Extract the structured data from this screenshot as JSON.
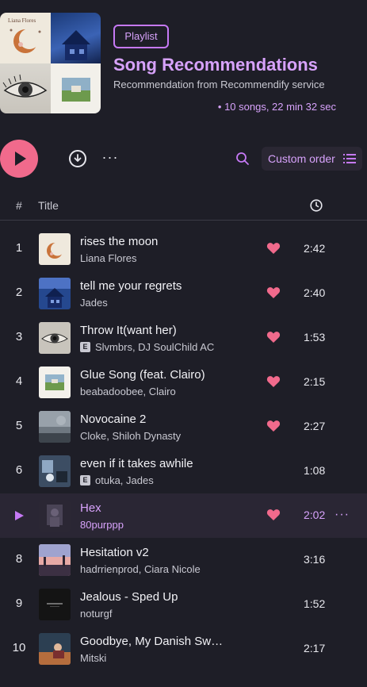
{
  "playlist": {
    "badge": "Playlist",
    "title": "Song Recommendations",
    "subtitle": "Recommendation from Recommendify service",
    "stats": "• 10 songs, 22 min 32 sec",
    "cover_text": "Liana Flores"
  },
  "controls": {
    "more_label": "···",
    "order_label": "Custom order"
  },
  "table": {
    "num_header": "#",
    "title_header": "Title"
  },
  "colors": {
    "accent": "#d7a2fb",
    "play_button": "#f16a8c",
    "heart": "#f16a8c",
    "background": "#1e1e27"
  },
  "tracks": [
    {
      "num": "1",
      "title": "rises the moon",
      "artist": "Liana Flores",
      "explicit": false,
      "liked": true,
      "duration": "2:42",
      "art": "art-moon"
    },
    {
      "num": "2",
      "title": "tell me your regrets",
      "artist": "Jades",
      "explicit": false,
      "liked": true,
      "duration": "2:40",
      "art": "art-house"
    },
    {
      "num": "3",
      "title": "Throw It(want her)",
      "artist": "Slvmbrs, DJ SoulChild AC",
      "explicit": true,
      "liked": true,
      "duration": "1:53",
      "art": "art-eye"
    },
    {
      "num": "4",
      "title": "Glue Song (feat. Clairo)",
      "artist": "beabadoobee, Clairo",
      "explicit": false,
      "liked": true,
      "duration": "2:15",
      "art": "art-field"
    },
    {
      "num": "5",
      "title": "Novocaine 2",
      "artist": "Cloke, Shiloh Dynasty",
      "explicit": false,
      "liked": true,
      "duration": "2:27",
      "art": "art-storm"
    },
    {
      "num": "6",
      "title": "even if it takes awhile",
      "artist": "otuka, Jades",
      "explicit": true,
      "liked": false,
      "duration": "1:08",
      "art": "art-room"
    },
    {
      "num": "",
      "title": "Hex",
      "artist": "80purppp",
      "explicit": false,
      "liked": true,
      "duration": "2:02",
      "art": "art-hex",
      "active": true
    },
    {
      "num": "8",
      "title": "Hesitation v2",
      "artist": "hadrrienprod, Ciara Nicole",
      "explicit": false,
      "liked": false,
      "duration": "3:16",
      "art": "art-sunset"
    },
    {
      "num": "9",
      "title": "Jealous - Sped Up",
      "artist": "noturgf",
      "explicit": false,
      "liked": false,
      "duration": "1:52",
      "art": "art-dark"
    },
    {
      "num": "10",
      "title": "Goodbye, My Danish Sw…",
      "artist": "Mitski",
      "explicit": false,
      "liked": false,
      "duration": "2:17",
      "art": "art-mitski"
    }
  ]
}
